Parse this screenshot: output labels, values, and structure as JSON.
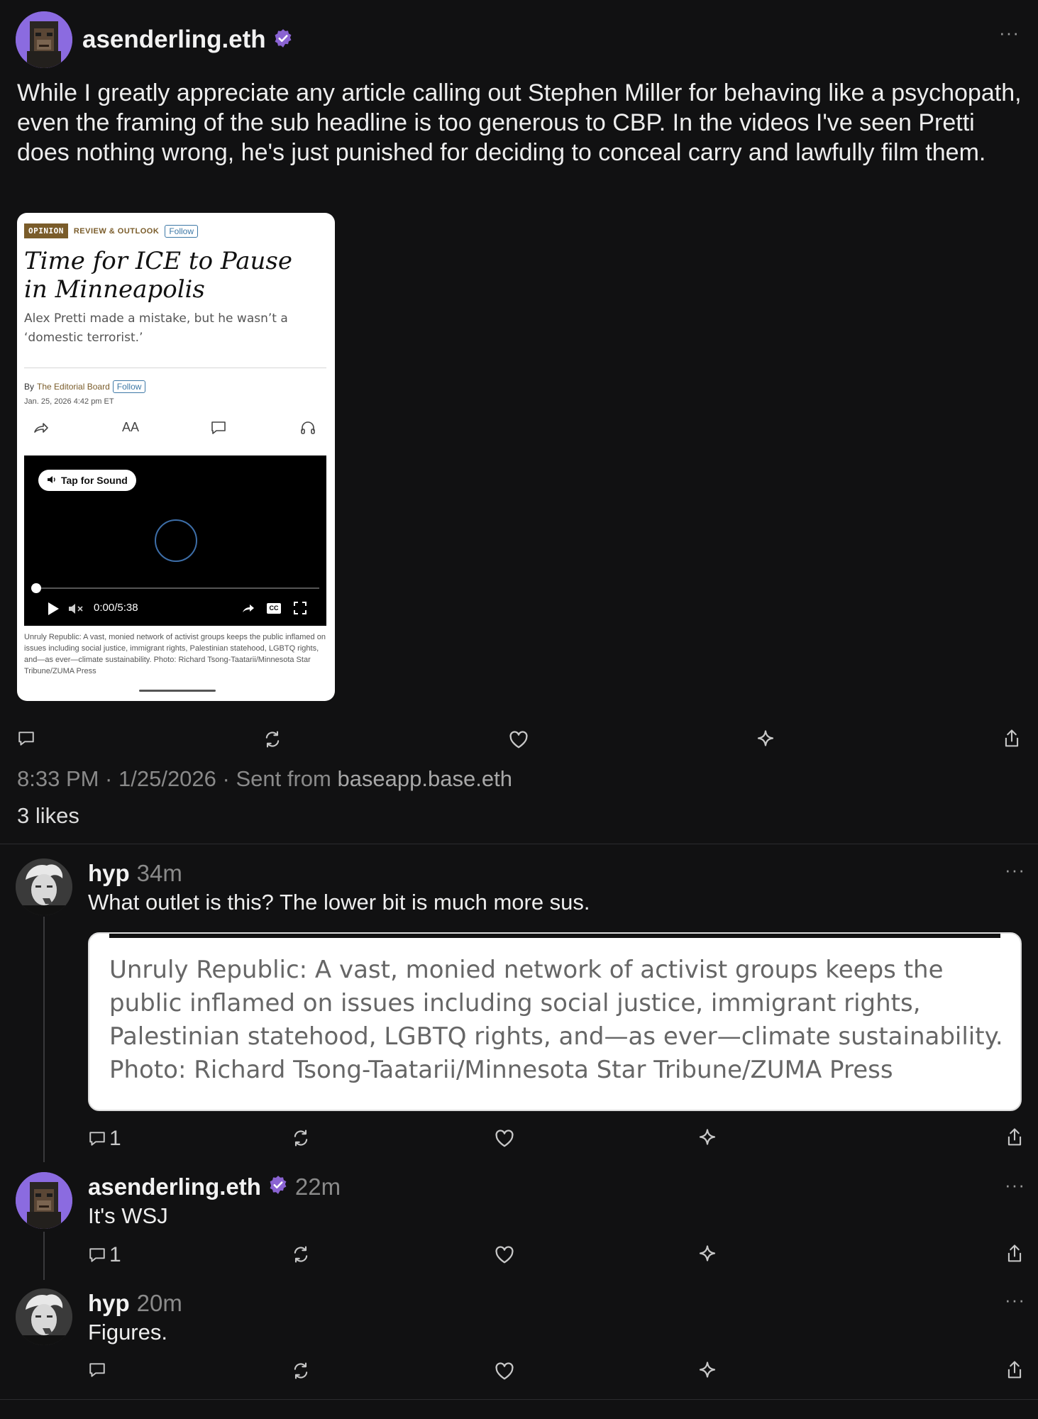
{
  "main_post": {
    "author": "asenderling.eth",
    "body": "While I greatly appreciate any article calling out Stephen Miller for behaving like a psychopath, even the framing of the sub headline is too generous to CBP. In the videos I've seen Pretti does nothing wrong, he's just punished for deciding to conceal carry and lawfully film them.",
    "meta_time": "8:33 PM · 1/25/2026 · Sent from ",
    "meta_source": "baseapp.base.eth",
    "likes": "3 likes",
    "embed": {
      "tag": "OPINION",
      "section": "REVIEW & OUTLOOK",
      "follow": "Follow",
      "headline": "Time for ICE to Pause in Minneapolis",
      "dek": "Alex Pretti made a mistake, but he wasn’t a ‘domestic terrorist.’",
      "byline_prefix": "By",
      "byline_author": "The Editorial Board",
      "byline_follow": "Follow",
      "date": "Jan. 25, 2026 4:42 pm ET",
      "text_size_icon": "AA",
      "tap_for_sound": "Tap for Sound",
      "video_time": "0:00/5:38",
      "caption": "Unruly Republic: A vast, monied network of activist groups keeps the public inflamed on issues including social justice, immigrant rights, Palestinian statehood, LGBTQ rights, and—as ever—climate sustainability. Photo: Richard Tsong-Taatarii/Minnesota Star Tribune/ZUMA Press"
    }
  },
  "replies": [
    {
      "author": "hyp",
      "time": "34m",
      "body": "What outlet is this? The lower bit is much more sus.",
      "quote": "Unruly Republic: A vast, monied network of activist groups keeps the public inflamed on issues including social justice, immigrant rights, Palestinian statehood, LGBTQ rights, and—as ever—climate sustainability. Photo: Richard Tsong-Taatarii/Minnesota Star Tribune/ZUMA Press",
      "reply_count": "1"
    },
    {
      "author": "asenderling.eth",
      "time": "22m",
      "body": "It's WSJ",
      "reply_count": "1"
    },
    {
      "author": "hyp",
      "time": "20m",
      "body": "Figures.",
      "reply_count": ""
    }
  ],
  "icons": [
    "reply-icon",
    "recast-icon",
    "like-icon",
    "sparkle-icon",
    "share-icon",
    "verified-icon",
    "more-icon"
  ],
  "colors": {
    "background": "#111112",
    "verified": "#8a63d2",
    "muted": "#8a8a8a"
  }
}
